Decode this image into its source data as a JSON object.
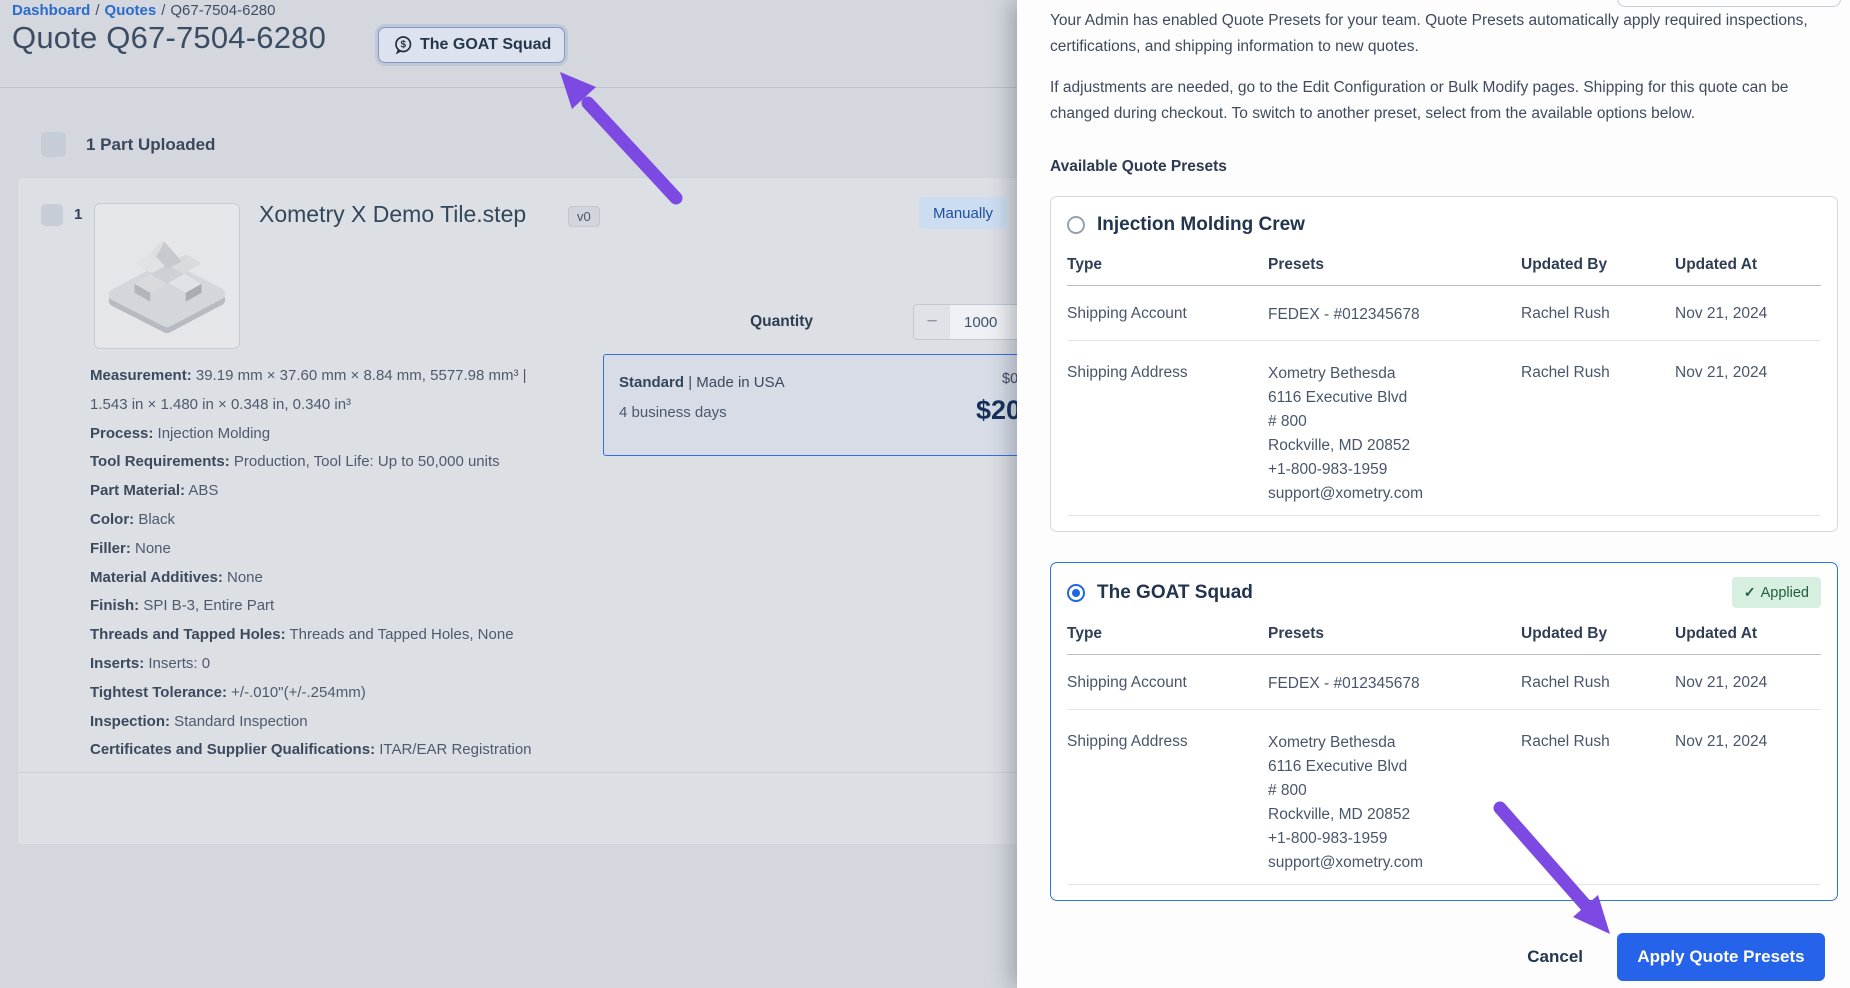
{
  "colors": {
    "accent_blue": "#2463ea",
    "link_blue": "#2a6bcc",
    "selected_border_blue": "#2e74e9",
    "applied_green_bg": "#d7efe0",
    "applied_green_text": "#205f3a",
    "annotation_purple": "#7c49e3"
  },
  "icons": {
    "team_badge_icon": "speech-bubble-dollar",
    "quantity_decrement_icon": "minus",
    "applied_check_icon": "check"
  },
  "page": {
    "breadcrumb": {
      "items": [
        "Dashboard",
        "Quotes",
        "Q67-7504-6280"
      ],
      "separator": "/"
    },
    "title": "Quote Q67-7504-6280",
    "team_badge_label": "The GOAT Squad",
    "parts_header": "1 Part Uploaded",
    "part": {
      "index": "1",
      "name": "Xometry X Demo Tile.step",
      "version": "v0",
      "config_badge": "Manually",
      "quantity_label": "Quantity",
      "quantity_minus": "−",
      "quantity_value": "1000",
      "lead_option": {
        "tier": "Standard",
        "separator": "|",
        "origin": "Made in USA",
        "days": "4 business days",
        "price_small": "$0",
        "price_big": "$20"
      },
      "specs": [
        {
          "label": "Measurement:",
          "value": "39.19 mm × 37.60 mm × 8.84 mm, 5577.98 mm³  |"
        },
        {
          "label": "",
          "value": "1.543 in × 1.480 in × 0.348 in, 0.340 in³"
        },
        {
          "label": "Process:",
          "value": "Injection Molding"
        },
        {
          "label": "Tool Requirements:",
          "value": "Production, Tool Life: Up to 50,000 units"
        },
        {
          "label": "Part Material:",
          "value": "ABS"
        },
        {
          "label": "Color:",
          "value": "Black"
        },
        {
          "label": "Filler:",
          "value": "None"
        },
        {
          "label": "Material Additives:",
          "value": "None"
        },
        {
          "label": "Finish:",
          "value": "SPI B-3, Entire Part"
        },
        {
          "label": "Threads and Tapped Holes:",
          "value": "Threads and Tapped Holes, None"
        },
        {
          "label": "Inserts:",
          "value": "Inserts: 0"
        },
        {
          "label": "Tightest Tolerance:",
          "value": "+/-.010\"(+/-.254mm)"
        },
        {
          "label": "Inspection:",
          "value": "Standard Inspection"
        },
        {
          "label": "Certificates and Supplier Qualifications:",
          "value": "ITAR/EAR Registration"
        }
      ]
    }
  },
  "drawer": {
    "intro1": "Your Admin has enabled Quote Presets for your team. Quote Presets automatically apply required inspections, certifications, and shipping information to new quotes.",
    "intro2": "If adjustments are needed, go to the Edit Configuration or Bulk Modify pages. Shipping for this quote can be changed during checkout. To switch to another preset, select from the available options below.",
    "section_title": "Available Quote Presets",
    "table_headers": [
      "Type",
      "Presets",
      "Updated By",
      "Updated At"
    ],
    "applied_label": "Applied",
    "applied_check": "✓",
    "presets": [
      {
        "name": "Injection Molding Crew",
        "selected": false,
        "applied": false,
        "rows": [
          {
            "type": "Shipping Account",
            "preset_lines": [
              "FEDEX - #012345678"
            ],
            "updated_by": "Rachel Rush",
            "updated_at": "Nov 21, 2024"
          },
          {
            "type": "Shipping Address",
            "preset_lines": [
              "Xometry Bethesda",
              "6116 Executive Blvd",
              "# 800",
              "Rockville, MD 20852",
              "+1-800-983-1959",
              "support@xometry.com"
            ],
            "updated_by": "Rachel Rush",
            "updated_at": "Nov 21, 2024"
          }
        ]
      },
      {
        "name": "The GOAT Squad",
        "selected": true,
        "applied": true,
        "rows": [
          {
            "type": "Shipping Account",
            "preset_lines": [
              "FEDEX - #012345678"
            ],
            "updated_by": "Rachel Rush",
            "updated_at": "Nov 21, 2024"
          },
          {
            "type": "Shipping Address",
            "preset_lines": [
              "Xometry Bethesda",
              "6116 Executive Blvd",
              "# 800",
              "Rockville, MD 20852",
              "+1-800-983-1959",
              "support@xometry.com"
            ],
            "updated_by": "Rachel Rush",
            "updated_at": "Nov 21, 2024"
          }
        ]
      }
    ],
    "cancel_label": "Cancel",
    "apply_label": "Apply Quote Presets"
  }
}
